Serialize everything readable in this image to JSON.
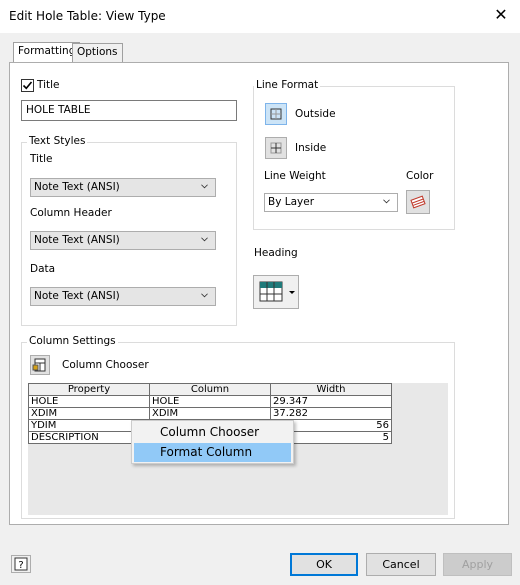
{
  "window": {
    "title": "Edit Hole Table: View Type",
    "close_icon": "close-icon"
  },
  "tabs": [
    {
      "label": "Formatting",
      "active": true
    },
    {
      "label": "Options",
      "active": false
    }
  ],
  "title_section": {
    "checkbox_checked": true,
    "checkbox_label": "Title",
    "title_value": "HOLE TABLE"
  },
  "text_styles": {
    "group_label": "Text Styles",
    "title_label": "Title",
    "title_value": "Note Text (ANSI)",
    "column_header_label": "Column Header",
    "column_header_value": "Note Text (ANSI)",
    "data_label": "Data",
    "data_value": "Note Text (ANSI)"
  },
  "line_format": {
    "group_label": "Line Format",
    "outside_label": "Outside",
    "inside_label": "Inside",
    "line_weight_label": "Line Weight",
    "line_weight_value": "By Layer",
    "color_label": "Color"
  },
  "heading": {
    "label": "Heading"
  },
  "column_settings": {
    "group_label": "Column Settings",
    "chooser_label": "Column Chooser",
    "headers": [
      "Property",
      "Column",
      "Width"
    ],
    "rows": [
      [
        "HOLE",
        "HOLE",
        "29.347"
      ],
      [
        "XDIM",
        "XDIM",
        "37.282"
      ],
      [
        "YDIM",
        "",
        "56"
      ],
      [
        "DESCRIPTION",
        "",
        "5"
      ]
    ]
  },
  "context_menu": {
    "items": [
      "Column Chooser",
      "Format Column"
    ],
    "highlighted_index": 1
  },
  "footer": {
    "ok_label": "OK",
    "cancel_label": "Cancel",
    "apply_label": "Apply",
    "help_icon": "help-icon"
  },
  "colors": {
    "accent": "#0078d7",
    "highlight": "#91c9f7",
    "teal_icon": "#1f7a7a"
  }
}
